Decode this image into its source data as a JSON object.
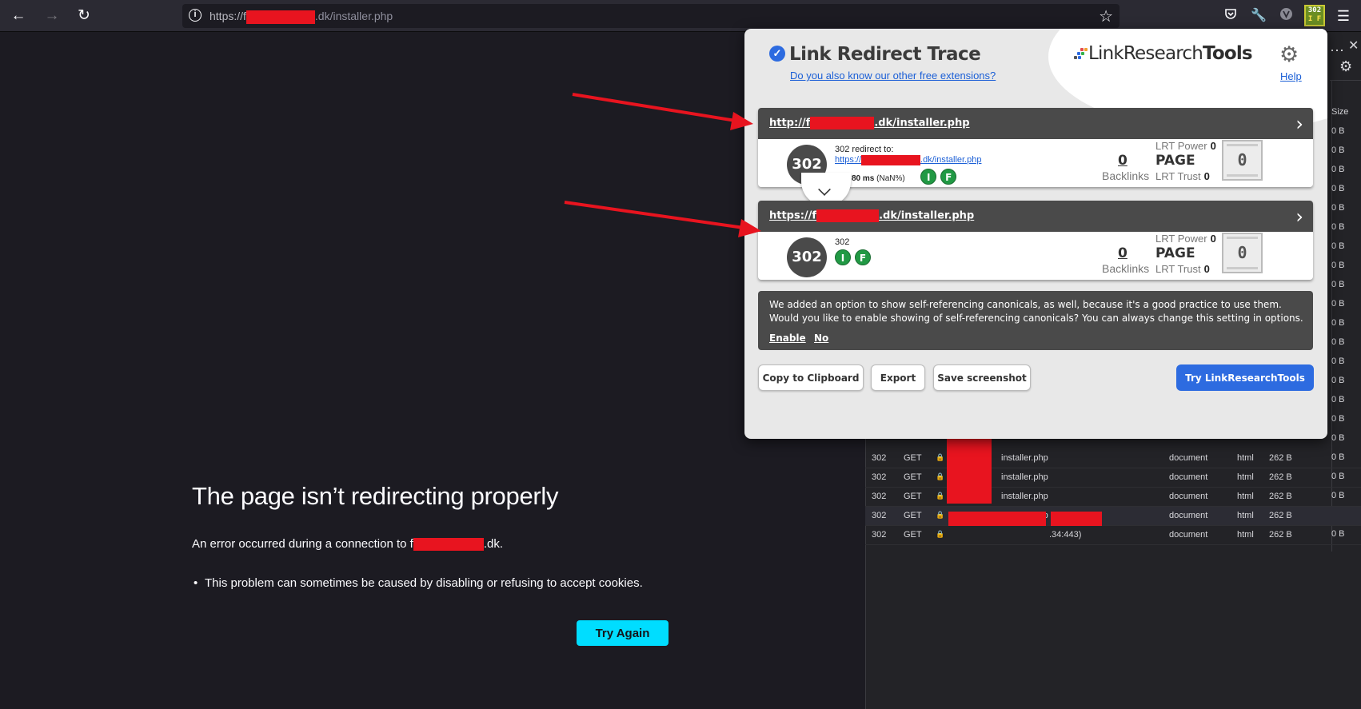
{
  "browser": {
    "url_prefix": "https://f",
    "url_suffix": ".dk/installer.php",
    "ext_badge_top": "302",
    "ext_badge_bottom": "I F"
  },
  "error_page": {
    "title": "The page isn’t redirecting properly",
    "desc_prefix": "An error occurred during a connection to f",
    "desc_suffix": ".dk.",
    "bullet": "This problem can sometimes be caused by disabling or refusing to accept cookies.",
    "try_again": "Try Again"
  },
  "devtools": {
    "size_header": "Size",
    "size_values": [
      "0 B",
      "0 B",
      "0 B",
      "0 B",
      "0 B",
      "0 B",
      "0 B",
      "0 B",
      "0 B",
      "0 B",
      "0 B",
      "0 B",
      "0 B",
      "0 B",
      "0 B",
      "0 B",
      "0 B",
      "0 B",
      "0 B",
      "0 B",
      "0 B",
      "0 B"
    ],
    "rows": [
      {
        "status": "302",
        "method": "GET",
        "file": "installer.php",
        "type": "document",
        "kind": "html",
        "size": "262 B"
      },
      {
        "status": "302",
        "method": "GET",
        "file": "installer.php",
        "type": "document",
        "kind": "html",
        "size": "262 B"
      },
      {
        "status": "302",
        "method": "GET",
        "file": "installer.php",
        "type": "document",
        "kind": "html",
        "size": "262 B"
      },
      {
        "status": "302",
        "method": "GET",
        "file": "installer.php",
        "type": "document",
        "kind": "html",
        "size": "262 B"
      },
      {
        "status": "302",
        "method": "GET",
        "file": ".34:443)",
        "type": "document",
        "kind": "html",
        "size": "262 B"
      }
    ]
  },
  "popup": {
    "title": "Link Redirect Trace",
    "ext_link": "Do you also know our other free extensions?",
    "brand_light": "Link",
    "brand_mid": "Research",
    "brand_bold": "Tools",
    "help": "Help",
    "hops": [
      {
        "url_prefix": "http://f",
        "url_suffix": ".dk/installer.php",
        "status": "302",
        "redirect_label": "302 redirect to:",
        "redirect_prefix": "https://",
        "redirect_suffix": ".dk/installer.php",
        "timing": "80 ms",
        "timing_pct": "(NaN%)",
        "badge_i": "I",
        "badge_f": "F",
        "backlinks": "0",
        "backlinks_label": "Backlinks",
        "lrt_power_label": "LRT Power",
        "lrt_power": "0",
        "page_label": "PAGE",
        "lrt_trust_label": "LRT Trust",
        "lrt_trust": "0",
        "score": "0"
      },
      {
        "url_prefix": "https://f",
        "url_suffix": ".dk/installer.php",
        "status": "302",
        "status_label": "302",
        "badge_i": "I",
        "badge_f": "F",
        "backlinks": "0",
        "backlinks_label": "Backlinks",
        "lrt_power_label": "LRT Power",
        "lrt_power": "0",
        "page_label": "PAGE",
        "lrt_trust_label": "LRT Trust",
        "lrt_trust": "0",
        "score": "0"
      }
    ],
    "notice": "We added an option to show self-referencing canonicals, as well, because it's a good practice to use them. Would you like to enable showing of self-referencing canonicals? You can always change this setting in options.",
    "notice_enable": "Enable",
    "notice_no": "No",
    "buttons": {
      "copy": "Copy to Clipboard",
      "export": "Export",
      "save": "Save screenshot",
      "try": "Try LinkResearchTools"
    }
  },
  "icons": {
    "back": "back-arrow-icon",
    "forward": "forward-arrow-icon",
    "reload": "reload-icon",
    "star": "star-icon",
    "pocket": "pocket-icon",
    "wrench": "wrench-icon",
    "menu": "hamburger-menu-icon",
    "gear": "gear-icon",
    "chevron_right": "chevron-right-icon",
    "chevron_down": "chevron-down-icon",
    "stopwatch": "stopwatch-icon",
    "lock": "lock-icon"
  },
  "colors": {
    "accent_blue": "#2d6be0",
    "try_again_bg": "#00ddff",
    "redaction": "#e8141f",
    "badge_green": "#219944",
    "hop_header": "#4a4a4a"
  }
}
